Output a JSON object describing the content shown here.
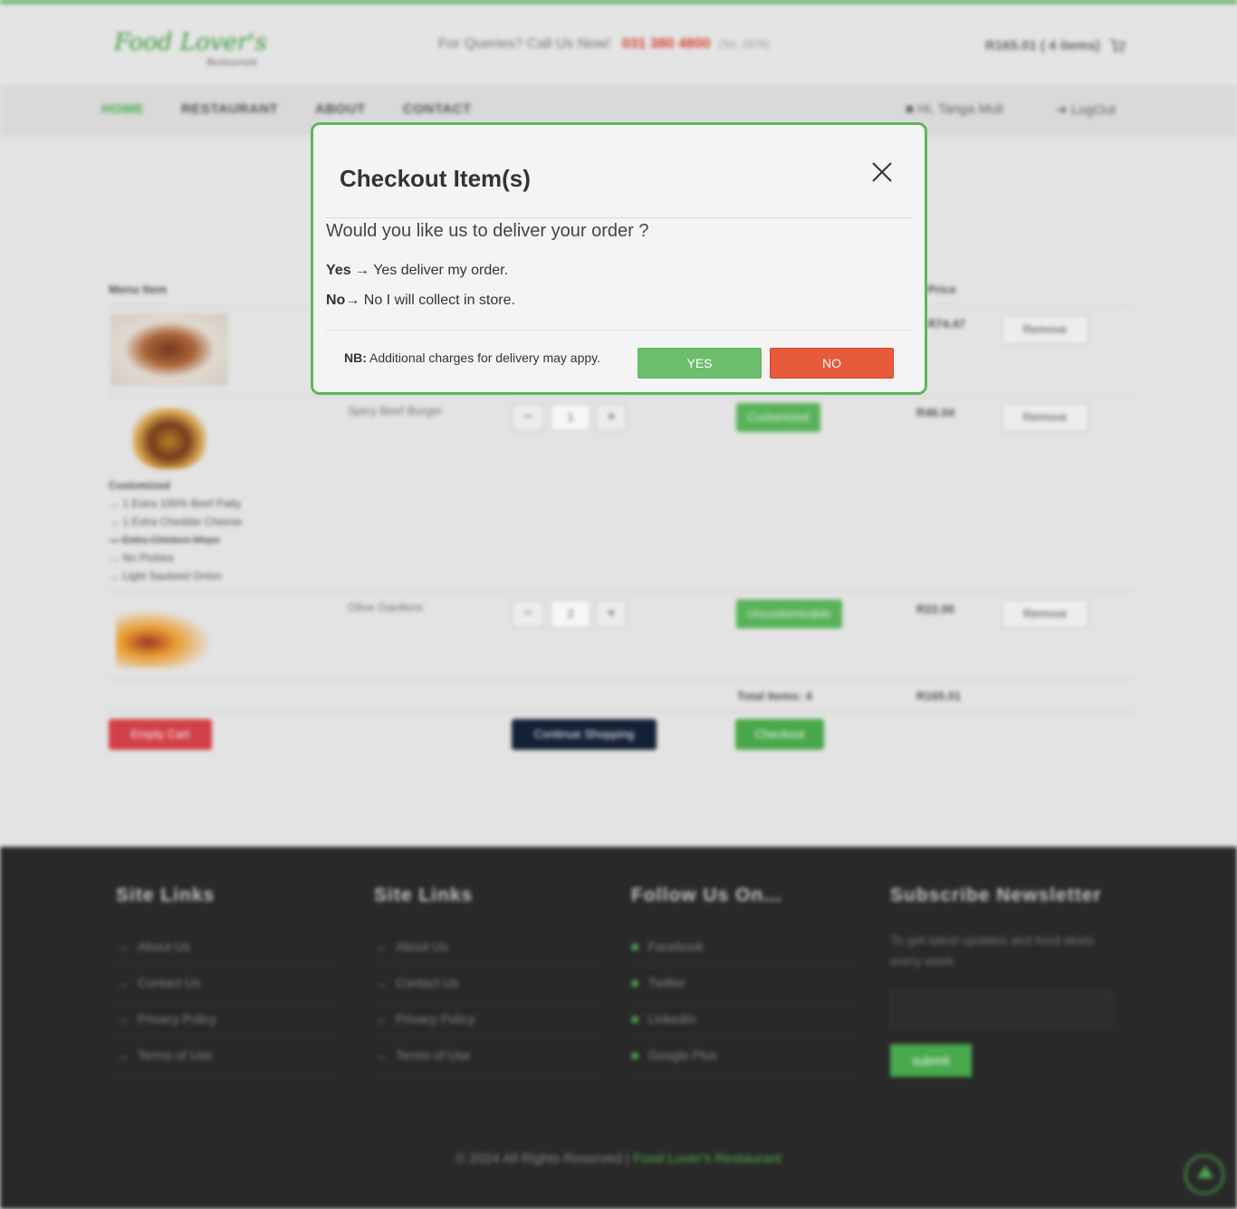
{
  "header": {
    "logo_main": "Food Lover's",
    "logo_sub": "Restaurant",
    "queries_label": "For Queries? Call Us Now!",
    "phone": "031 380 4800",
    "phone_note": "(Tel. 1978)",
    "cart_summary": "R165.01 ( 4 items)"
  },
  "nav": {
    "items": [
      "HOME",
      "RESTAURANT",
      "ABOUT",
      "CONTACT"
    ],
    "user": "Hi, Tanga Muli",
    "logout": "LogOut"
  },
  "cart": {
    "columns": [
      "Menu Item",
      "Price"
    ],
    "rows": [
      {
        "name": "",
        "qty": "",
        "price": "R74.47",
        "remove": "Remove"
      },
      {
        "name": "Spicy Beef Burger",
        "qty": "1",
        "action": "Customized",
        "price": "R46.04",
        "remove": "Remove",
        "customized_title": "Customized",
        "customizations": [
          "→ 1 Extra 100% Beef Patty",
          "→ 1 Extra Cheddar Cheese",
          "→ Extra Chicken Mayo",
          "→ No Pickles",
          "→ Light Sauteed Onion"
        ]
      },
      {
        "name": "Olive Gardens",
        "qty": "2",
        "action": "Uncustomizable",
        "price": "R22.00",
        "remove": "Remove"
      }
    ],
    "total_items_label": "Total Items: 4",
    "total_price": "R165.01",
    "empty_cart": "Empty Cart",
    "continue_shopping": "Continue Shopping",
    "checkout": "Checkout"
  },
  "footer": {
    "col1_title": "Site Links",
    "col1_links": [
      "About Us",
      "Contact Us",
      "Privacy Policy",
      "Terms of Use"
    ],
    "col2_title": "Site Links",
    "col2_links": [
      "About Us",
      "Contact Us",
      "Privacy Policy",
      "Terms of Use"
    ],
    "col3_title": "Follow Us On...",
    "col3_links": [
      "Facebook",
      "Twitter",
      "LinkedIn",
      "Google Plus"
    ],
    "col4_title": "Subscribe Newsletter",
    "newsletter_text": "To get latest updates and food deals every week",
    "submit": "submit",
    "copyright": "© 2024 All Rights Reserved |",
    "brand": "Food Lover's Restaurant"
  },
  "modal": {
    "title": "Checkout Item(s)",
    "question": "Would you like us to deliver your order ?",
    "yes_label": "Yes",
    "yes_text": " → Yes deliver my order.",
    "no_label": "No",
    "no_text": "→ No I will collect in store.",
    "note_label": "NB:",
    "note_text": " Additional charges for delivery may appy.",
    "yes_button": "YES",
    "no_button": "NO"
  },
  "colors": {
    "accent_green": "#5cb85c",
    "danger_red": "#e75a3a",
    "footer_bg": "#2b2b2b"
  }
}
